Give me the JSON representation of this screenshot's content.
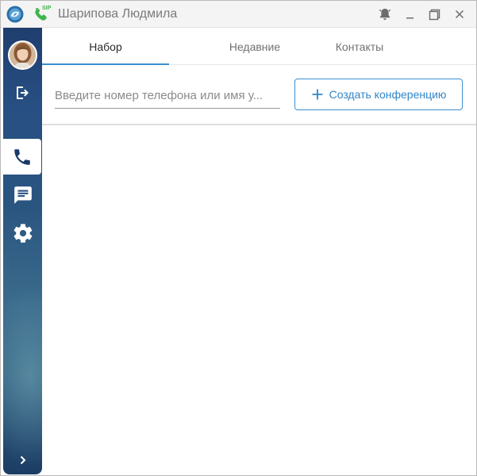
{
  "window": {
    "title": "Шарипова Людмила",
    "sip_badge": "SIP"
  },
  "tabs": [
    {
      "label": "Набор",
      "active": true
    },
    {
      "label": "Недавние",
      "active": false
    },
    {
      "label": "Контакты",
      "active": false
    }
  ],
  "dial": {
    "search_placeholder": "Введите номер телефона или имя у...",
    "conference_button_label": "Создать конференцию"
  },
  "sidebar": {
    "items": [
      {
        "name": "avatar",
        "icon": "user-photo"
      },
      {
        "name": "logout",
        "icon": "logout-icon"
      },
      {
        "name": "calls",
        "icon": "phone-icon",
        "active": true
      },
      {
        "name": "chat",
        "icon": "chat-icon"
      },
      {
        "name": "settings",
        "icon": "gear-icon"
      },
      {
        "name": "expand",
        "icon": "chevron-right-icon"
      }
    ]
  },
  "colors": {
    "accent": "#3a8fd0",
    "sip_green": "#3fb54a",
    "sidebar_top": "#1f3e6e"
  }
}
